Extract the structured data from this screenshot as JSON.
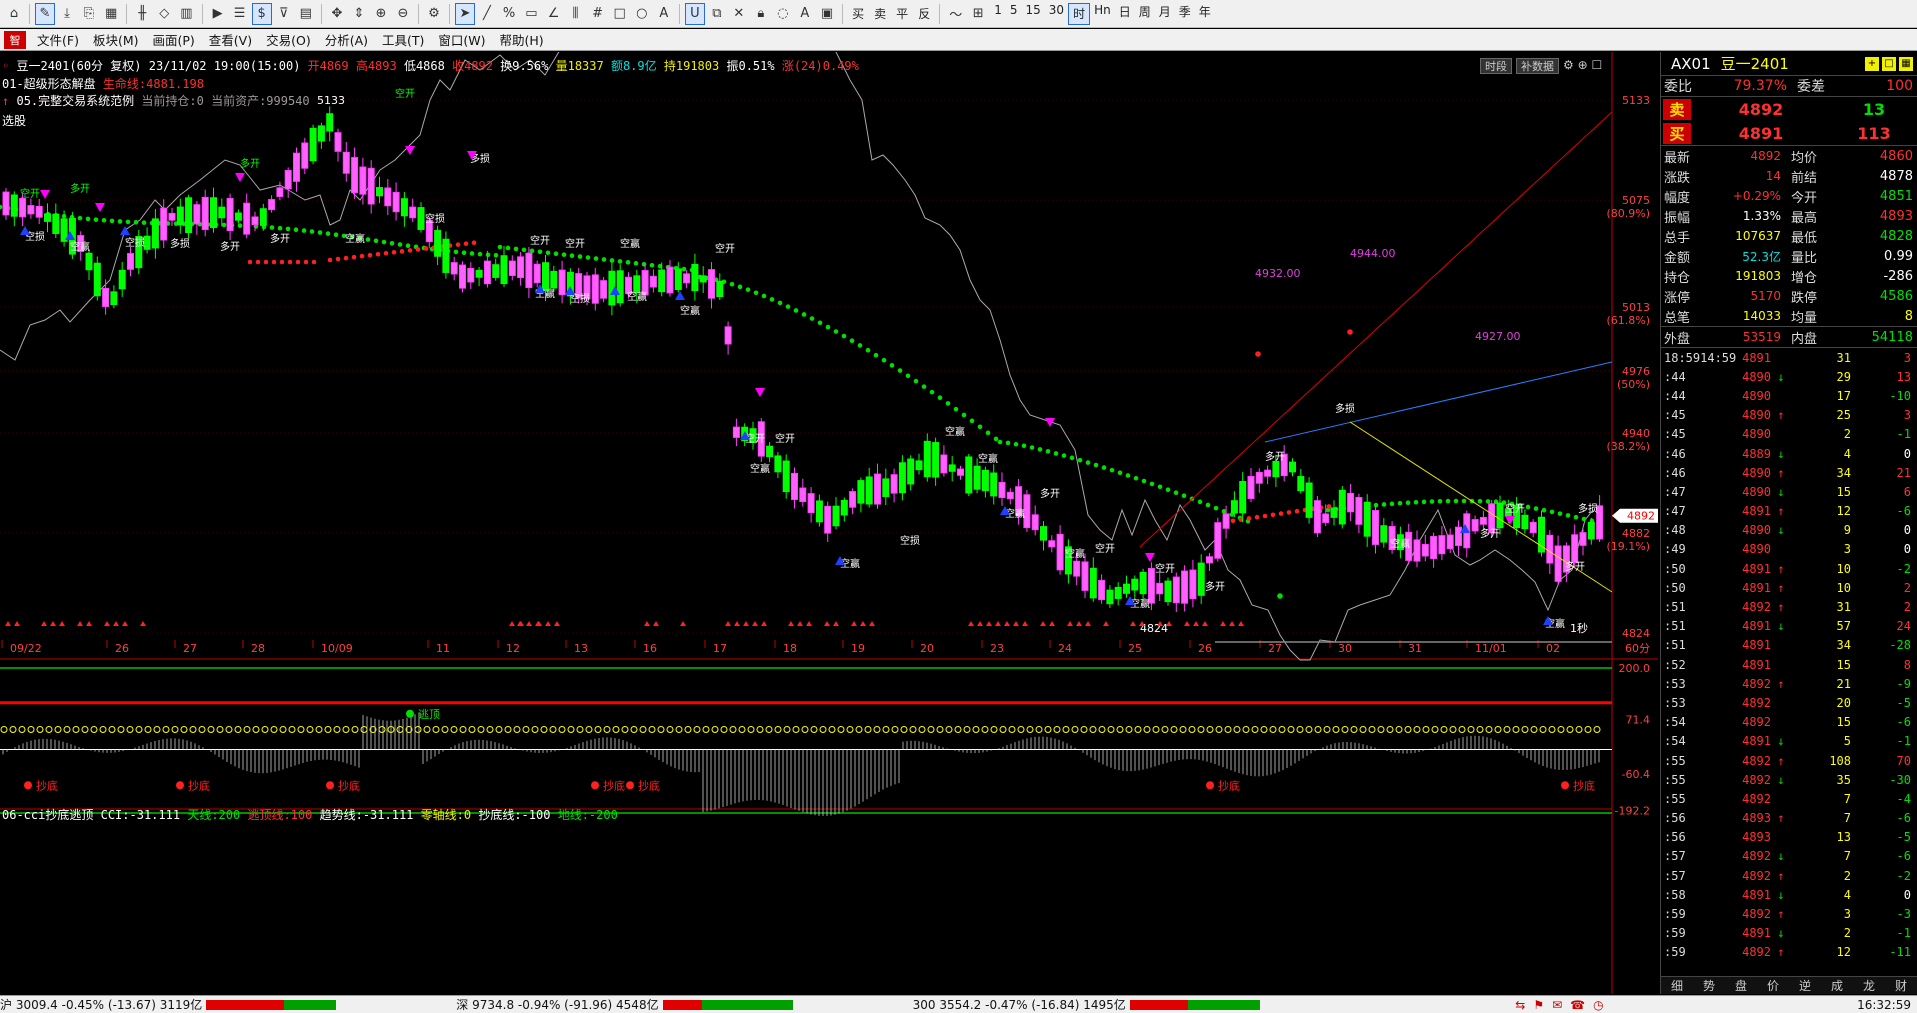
{
  "toolbar": {
    "periods": [
      "1",
      "5",
      "15",
      "30",
      "时",
      "Hn",
      "日",
      "周",
      "月",
      "季",
      "年"
    ],
    "active_period": "时",
    "tools_text": [
      "买",
      "卖",
      "平",
      "反"
    ]
  },
  "menu": {
    "logo": "智",
    "items": [
      "文件(F)",
      "板块(M)",
      "画面(P)",
      "查看(V)",
      "交易(O)",
      "分析(A)",
      "工具(T)",
      "窗口(W)",
      "帮助(H)"
    ]
  },
  "chart": {
    "title": "豆一2401(60分 复权) 23/11/02 19:00(15:00)",
    "open": "开4869",
    "high": "高4893",
    "low": "低4868",
    "close": "收4892",
    "turnover": "换9.56%",
    "volume": "量18337",
    "amount": "额8.9亿",
    "position": "持191803",
    "amplitude": "振0.51%",
    "change": "涨(24)0.49%",
    "indicator1": "01-超级形态解盘",
    "lifeline": "生命线:4881.198",
    "indicator2": "05.完整交易系统范例",
    "holding": "当前持仓:0",
    "assets": "当前资产:999540",
    "select_label": "选股",
    "tab_time": "时段",
    "tab_data": "补数据",
    "period_label": "60分",
    "price_labels": [
      "5133",
      "5075",
      "5013",
      "4976",
      "4940",
      "4882",
      "4824"
    ],
    "pct_labels": [
      "(80.9%)",
      "(61.8%)",
      "(50%)",
      "(38.2%)",
      "(19.1%)"
    ],
    "current_price_tag": "4892",
    "date_labels": [
      "09/22",
      "26",
      "27",
      "28",
      "10/09",
      "11",
      "12",
      "13",
      "16",
      "17",
      "18",
      "19",
      "20",
      "23",
      "24",
      "25",
      "26",
      "27",
      "30",
      "31",
      "11/01",
      "02"
    ],
    "annotations": {
      "high_mark": "5133",
      "low_mark": "4824",
      "magenta_labels": [
        "4932.00",
        "4944.00",
        "4927.00"
      ],
      "seconds": "1秒"
    },
    "signal_labels": {
      "empty_open": "空开",
      "long_open": "多开",
      "empty_win": "空赢",
      "empty_loss": "空损",
      "long_loss": "多损",
      "neg_one": "-1",
      "one": "1"
    }
  },
  "indicator": {
    "name": "06-cci抄底逃顶",
    "cci": "CCI:-31.111",
    "sky": "天线:200",
    "escape": "逃顶线:100",
    "trend": "趋势线:-31.111",
    "zero": "零轴线:0",
    "bottom": "抄底线:-100",
    "ground": "地线:-200",
    "axis_labels": [
      "200.0",
      "71.4",
      "-60.4",
      "-192.2"
    ],
    "escape_label": "逃顶",
    "bottom_label": "抄底"
  },
  "quote": {
    "code": "AX01",
    "name": "豆一2401",
    "weibi_label": "委比",
    "weibi": "79.37%",
    "weicha_label": "委差",
    "weicha": "100",
    "sell_label": "卖",
    "sell_price": "4892",
    "sell_vol": "13",
    "buy_label": "买",
    "buy_price": "4891",
    "buy_vol": "113",
    "rows": [
      {
        "l1": "最新",
        "v1": "4892",
        "c1": "red",
        "l2": "均价",
        "v2": "4860",
        "c2": "red"
      },
      {
        "l1": "涨跌",
        "v1": "14",
        "c1": "red",
        "l2": "前结",
        "v2": "4878",
        "c2": "white"
      },
      {
        "l1": "幅度",
        "v1": "+0.29%",
        "c1": "red",
        "l2": "今开",
        "v2": "4851",
        "c2": "green"
      },
      {
        "l1": "振幅",
        "v1": "1.33%",
        "c1": "white",
        "l2": "最高",
        "v2": "4893",
        "c2": "red"
      },
      {
        "l1": "总手",
        "v1": "107637",
        "c1": "yellow",
        "l2": "最低",
        "v2": "4828",
        "c2": "green"
      },
      {
        "l1": "金额",
        "v1": "52.3亿",
        "c1": "cyan",
        "l2": "量比",
        "v2": "0.99",
        "c2": "white"
      },
      {
        "l1": "持仓",
        "v1": "191803",
        "c1": "yellow",
        "l2": "增仓",
        "v2": "-286",
        "c2": "white"
      },
      {
        "l1": "涨停",
        "v1": "5170",
        "c1": "red",
        "l2": "跌停",
        "v2": "4586",
        "c2": "green"
      },
      {
        "l1": "总笔",
        "v1": "14033",
        "c1": "yellow",
        "l2": "均量",
        "v2": "8",
        "c2": "yellow"
      }
    ],
    "outer_label": "外盘",
    "outer": "53519",
    "inner_label": "内盘",
    "inner": "54118"
  },
  "ticks": [
    {
      "t": "18:5914:59",
      "p": "4891",
      "a": "",
      "v": "31",
      "d": "3",
      "dc": "red"
    },
    {
      "t": ":44",
      "p": "4890",
      "a": "↓",
      "v": "29",
      "d": "13",
      "dc": "red"
    },
    {
      "t": ":44",
      "p": "4890",
      "a": "",
      "v": "17",
      "d": "-10",
      "dc": "green"
    },
    {
      "t": ":45",
      "p": "4890",
      "a": "↑",
      "v": "25",
      "d": "3",
      "dc": "red"
    },
    {
      "t": ":45",
      "p": "4890",
      "a": "",
      "v": "2",
      "d": "-1",
      "dc": "green"
    },
    {
      "t": ":46",
      "p": "4889",
      "a": "↓",
      "v": "4",
      "d": "0",
      "dc": "white"
    },
    {
      "t": ":46",
      "p": "4890",
      "a": "↑",
      "v": "34",
      "d": "21",
      "dc": "red"
    },
    {
      "t": ":47",
      "p": "4890",
      "a": "↓",
      "v": "15",
      "d": "6",
      "dc": "red"
    },
    {
      "t": ":47",
      "p": "4891",
      "a": "↑",
      "v": "12",
      "d": "-6",
      "dc": "green"
    },
    {
      "t": ":48",
      "p": "4890",
      "a": "↓",
      "v": "9",
      "d": "0",
      "dc": "white"
    },
    {
      "t": ":49",
      "p": "4890",
      "a": "",
      "v": "3",
      "d": "0",
      "dc": "white"
    },
    {
      "t": ":50",
      "p": "4891",
      "a": "↑",
      "v": "10",
      "d": "-2",
      "dc": "green"
    },
    {
      "t": ":50",
      "p": "4891",
      "a": "↑",
      "v": "10",
      "d": "2",
      "dc": "red"
    },
    {
      "t": ":51",
      "p": "4892",
      "a": "↑",
      "v": "31",
      "d": "2",
      "dc": "red"
    },
    {
      "t": ":51",
      "p": "4891",
      "a": "↓",
      "v": "57",
      "d": "24",
      "dc": "red"
    },
    {
      "t": ":51",
      "p": "4891",
      "a": "",
      "v": "34",
      "d": "-28",
      "dc": "green"
    },
    {
      "t": ":52",
      "p": "4891",
      "a": "",
      "v": "15",
      "d": "8",
      "dc": "red"
    },
    {
      "t": ":53",
      "p": "4892",
      "a": "↑",
      "v": "21",
      "d": "-9",
      "dc": "green"
    },
    {
      "t": ":53",
      "p": "4892",
      "a": "",
      "v": "20",
      "d": "-5",
      "dc": "green"
    },
    {
      "t": ":54",
      "p": "4892",
      "a": "",
      "v": "15",
      "d": "-6",
      "dc": "green"
    },
    {
      "t": ":54",
      "p": "4891",
      "a": "↓",
      "v": "5",
      "d": "-1",
      "dc": "green"
    },
    {
      "t": ":55",
      "p": "4892",
      "a": "↑",
      "v": "108",
      "d": "70",
      "dc": "red"
    },
    {
      "t": ":55",
      "p": "4892",
      "a": "↓",
      "v": "35",
      "d": "-30",
      "dc": "green"
    },
    {
      "t": ":55",
      "p": "4892",
      "a": "",
      "v": "7",
      "d": "-4",
      "dc": "green"
    },
    {
      "t": ":56",
      "p": "4893",
      "a": "↑",
      "v": "7",
      "d": "-6",
      "dc": "green"
    },
    {
      "t": ":56",
      "p": "4893",
      "a": "",
      "v": "13",
      "d": "-5",
      "dc": "green"
    },
    {
      "t": ":57",
      "p": "4892",
      "a": "↓",
      "v": "7",
      "d": "-6",
      "dc": "green"
    },
    {
      "t": ":57",
      "p": "4892",
      "a": "↑",
      "v": "2",
      "d": "-2",
      "dc": "green"
    },
    {
      "t": ":58",
      "p": "4891",
      "a": "↓",
      "v": "4",
      "d": "0",
      "dc": "white"
    },
    {
      "t": ":59",
      "p": "4892",
      "a": "↑",
      "v": "3",
      "d": "-3",
      "dc": "green"
    },
    {
      "t": ":59",
      "p": "4891",
      "a": "↓",
      "v": "2",
      "d": "-1",
      "dc": "green"
    },
    {
      "t": ":59",
      "p": "4892",
      "a": "↑",
      "v": "12",
      "d": "-11",
      "dc": "green"
    }
  ],
  "panel_tabs": [
    "细",
    "势",
    "盘",
    "价",
    "逆",
    "成",
    "龙",
    "财"
  ],
  "status": {
    "sh": "沪 3009.4  -0.45% (-13.67)  3119亿",
    "sz": "深 9734.8  -0.94% (-91.96)  4548亿",
    "hs300": "300 3554.2  -0.47% (-16.84)  1495亿",
    "time": "16:32:59"
  }
}
